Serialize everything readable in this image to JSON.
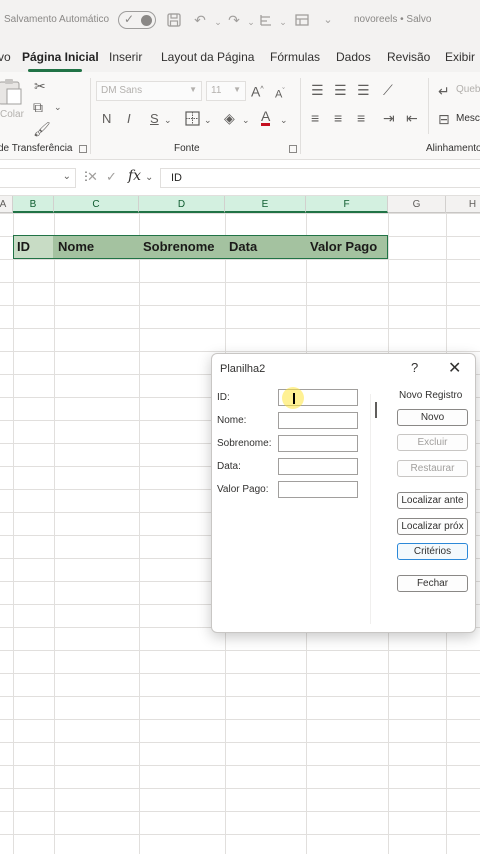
{
  "titlebar": {
    "autosave_label": "Salvamento Automático",
    "filename": "novoreels • Salvo",
    "icons": [
      "save-icon",
      "undo-icon",
      "redo-icon",
      "format-icon",
      "view-icon",
      "more-icon"
    ]
  },
  "tabs": [
    "vo",
    "Página Inicial",
    "Inserir",
    "Layout da Página",
    "Fórmulas",
    "Dados",
    "Revisão",
    "Exibir"
  ],
  "ribbon": {
    "clipboard": {
      "paste_label": "Colar",
      "group_label": "de Transferência"
    },
    "font": {
      "font_name": "DM Sans",
      "font_size": "11",
      "grow_label": "A",
      "shrink_label": "A",
      "bold": "N",
      "italic": "I",
      "underline": "S",
      "group_label": "Fonte"
    },
    "alignment": {
      "wrap_label": "Queb",
      "merge_label": "Mesc",
      "group_label": "Alinhamento"
    }
  },
  "formula_bar": {
    "fx_label": "fx",
    "value": "ID"
  },
  "grid": {
    "columns": [
      "A",
      "B",
      "C",
      "D",
      "E",
      "F",
      "G",
      "H"
    ],
    "header_row": [
      "ID",
      "Nome",
      "Sobrenome",
      "Data",
      "Valor Pago"
    ]
  },
  "dialog": {
    "title": "Planilha2",
    "help": "?",
    "close": "✕",
    "record_label": "Novo Registro",
    "fields": [
      {
        "label": "ID:",
        "value": ""
      },
      {
        "label": "Nome:",
        "value": ""
      },
      {
        "label": "Sobrenome:",
        "value": ""
      },
      {
        "label": "Data:",
        "value": ""
      },
      {
        "label": "Valor Pago:",
        "value": ""
      }
    ],
    "buttons": {
      "new": "Novo",
      "delete": "Excluir",
      "restore": "Restaurar",
      "find_prev": "Localizar ante",
      "find_next": "Localizar próx",
      "criteria": "Critérios",
      "close": "Fechar"
    }
  },
  "colors": {
    "accent": "#217346",
    "header_fill": "#a4c2a0",
    "focus_blue": "#2b88d8"
  }
}
